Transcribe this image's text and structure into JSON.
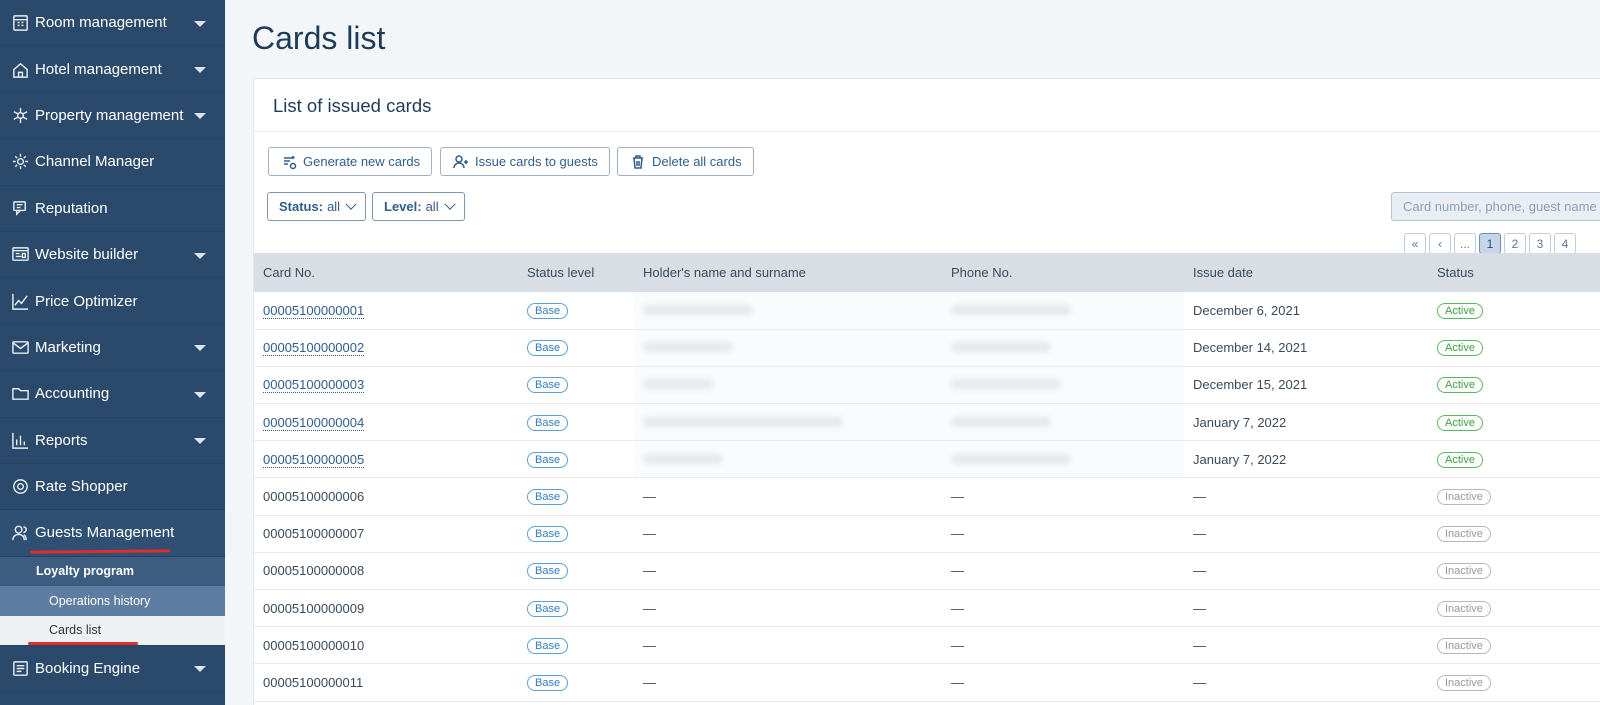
{
  "sidebar": {
    "items": [
      {
        "label": "Room management",
        "icon": "calendar-grid-icon",
        "has_caret": true
      },
      {
        "label": "Hotel management",
        "icon": "house-icon",
        "has_caret": true
      },
      {
        "label": "Property management",
        "icon": "snowflake-icon",
        "has_caret": true
      },
      {
        "label": "Channel Manager",
        "icon": "gear-icon",
        "has_caret": false
      },
      {
        "label": "Reputation",
        "icon": "chat-icon",
        "has_caret": false
      },
      {
        "label": "Website builder",
        "icon": "web-icon",
        "has_caret": true
      },
      {
        "label": "Price Optimizer",
        "icon": "chart-line-icon",
        "has_caret": false
      },
      {
        "label": "Marketing",
        "icon": "envelope-icon",
        "has_caret": true
      },
      {
        "label": "Accounting",
        "icon": "folder-icon",
        "has_caret": true
      },
      {
        "label": "Reports",
        "icon": "bar-chart-icon",
        "has_caret": true
      },
      {
        "label": "Rate Shopper",
        "icon": "coin-icon",
        "has_caret": false
      },
      {
        "label": "Guests Management",
        "icon": "users-icon",
        "has_caret": false
      }
    ],
    "sub": {
      "loyalty": "Loyalty program",
      "operations": "Operations history",
      "cards": "Cards list"
    },
    "bottom": {
      "label": "Booking Engine",
      "icon": "booking-icon"
    }
  },
  "page": {
    "title": "Cards list",
    "card_title": "List of issued cards"
  },
  "toolbar": {
    "generate": "Generate new cards",
    "issue": "Issue cards to guests",
    "delete": "Delete all cards"
  },
  "filters": {
    "status_label": "Status:",
    "status_value": "all",
    "level_label": "Level:",
    "level_value": "all"
  },
  "search": {
    "placeholder": "Card number, phone, guest name"
  },
  "pager": {
    "first": "«",
    "prev": "‹",
    "ellipsis": "...",
    "pages": [
      "1",
      "2",
      "3",
      "4"
    ],
    "current": "1"
  },
  "table": {
    "headers": [
      "Card No.",
      "Status level",
      "Holder's name and surname",
      "Phone No.",
      "Issue date",
      "Status"
    ],
    "rows": [
      {
        "card": "00005100000001",
        "level": "Base",
        "name": "",
        "phone": "",
        "date": "December 6, 2021",
        "status": "Active",
        "linked": true
      },
      {
        "card": "00005100000002",
        "level": "Base",
        "name": "",
        "phone": "",
        "date": "December 14, 2021",
        "status": "Active",
        "linked": true
      },
      {
        "card": "00005100000003",
        "level": "Base",
        "name": "",
        "phone": "",
        "date": "December 15, 2021",
        "status": "Active",
        "linked": true
      },
      {
        "card": "00005100000004",
        "level": "Base",
        "name": "",
        "phone": "",
        "date": "January 7, 2022",
        "status": "Active",
        "linked": true
      },
      {
        "card": "00005100000005",
        "level": "Base",
        "name": "",
        "phone": "",
        "date": "January 7, 2022",
        "status": "Active",
        "linked": true
      },
      {
        "card": "00005100000006",
        "level": "Base",
        "name": "—",
        "phone": "—",
        "date": "—",
        "status": "Inactive",
        "linked": false
      },
      {
        "card": "00005100000007",
        "level": "Base",
        "name": "—",
        "phone": "—",
        "date": "—",
        "status": "Inactive",
        "linked": false
      },
      {
        "card": "00005100000008",
        "level": "Base",
        "name": "—",
        "phone": "—",
        "date": "—",
        "status": "Inactive",
        "linked": false
      },
      {
        "card": "00005100000009",
        "level": "Base",
        "name": "—",
        "phone": "—",
        "date": "—",
        "status": "Inactive",
        "linked": false
      },
      {
        "card": "00005100000010",
        "level": "Base",
        "name": "—",
        "phone": "—",
        "date": "—",
        "status": "Inactive",
        "linked": false
      },
      {
        "card": "00005100000011",
        "level": "Base",
        "name": "—",
        "phone": "—",
        "date": "—",
        "status": "Inactive",
        "linked": false
      }
    ]
  },
  "colors": {
    "sidebar_bg": "#2b4a6b",
    "accent": "#2f5d8c",
    "active_green": "#3ea043",
    "annotation_red": "#e02d2d"
  }
}
